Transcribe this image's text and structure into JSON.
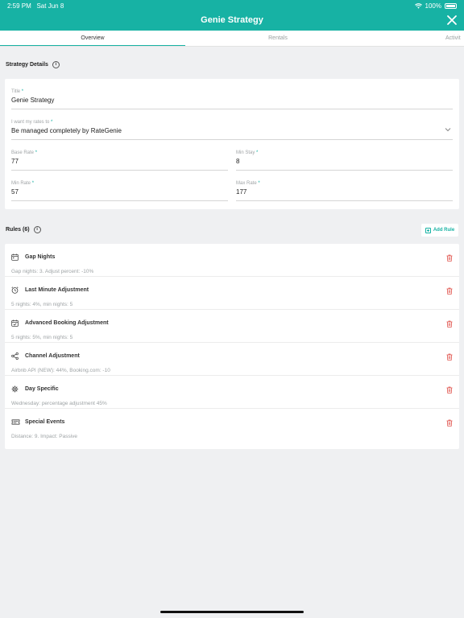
{
  "status": {
    "time": "2:59 PM",
    "date": "Sat Jun 8",
    "battery": "100%"
  },
  "header": {
    "title": "Genie Strategy"
  },
  "tabs": [
    "Overview",
    "Rentals",
    "Activit"
  ],
  "strategy_details": {
    "heading": "Strategy Details",
    "fields": {
      "title": {
        "label": "Title",
        "value": "Genie Strategy"
      },
      "rates_mode": {
        "label": "I want my rates to",
        "value": "Be managed completely by RateGenie"
      },
      "base_rate": {
        "label": "Base Rate",
        "value": "77"
      },
      "min_stay": {
        "label": "Min Stay",
        "value": "8"
      },
      "min_rate": {
        "label": "Min Rate",
        "value": "57"
      },
      "max_rate": {
        "label": "Max Rate",
        "value": "177"
      }
    }
  },
  "rules": {
    "heading": "Rules (6)",
    "add_label": "Add Rule",
    "items": [
      {
        "name": "Gap Nights",
        "desc": "Gap nights: 3. Adjust percent: -10%",
        "icon": "calendar-icon"
      },
      {
        "name": "Last Minute Adjustment",
        "desc": "5 nights: 4%, min nights: 5",
        "icon": "alarm-clock-icon"
      },
      {
        "name": "Advanced Booking Adjustment",
        "desc": "5 nights: 5%, min nights: 5",
        "icon": "calendar-check-icon"
      },
      {
        "name": "Channel Adjustment",
        "desc": "Airbnb API (NEW): 44%, Booking.com: -10",
        "icon": "share-icon"
      },
      {
        "name": "Day Specific",
        "desc": "Wednesday: percentage adjustment 45%",
        "icon": "gear-icon"
      },
      {
        "name": "Special Events",
        "desc": "Distance: 9. Impact: Passive",
        "icon": "ticket-icon"
      }
    ]
  },
  "colors": {
    "accent": "#17b2a4",
    "delete": "#e0504a"
  }
}
